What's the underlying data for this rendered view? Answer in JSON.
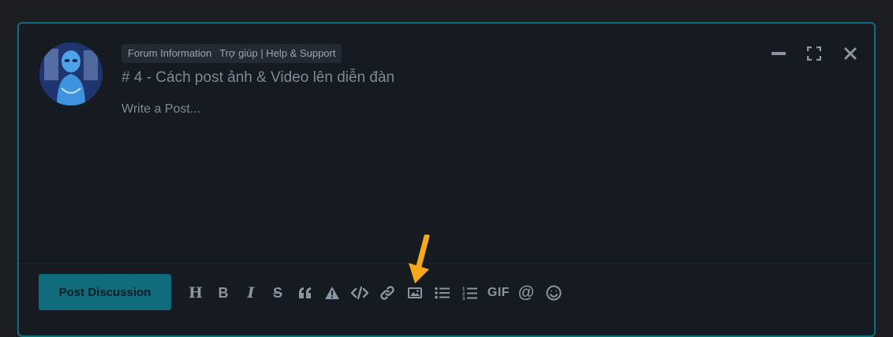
{
  "composer": {
    "tags": [
      "Forum Information",
      "Trợ giúp | Help & Support"
    ],
    "title": "# 4 - Cách post ảnh & Video lên diễn đàn",
    "body_placeholder": "Write a Post...",
    "submit_label": "Post Discussion"
  },
  "toolbar": {
    "items": [
      {
        "icon": "heading-icon",
        "label": "H"
      },
      {
        "icon": "bold-icon",
        "label": "B"
      },
      {
        "icon": "italic-icon",
        "label": "I"
      },
      {
        "icon": "strikethrough-icon",
        "label": "S"
      },
      {
        "icon": "quote-icon",
        "label": ""
      },
      {
        "icon": "spoiler-icon",
        "label": ""
      },
      {
        "icon": "code-icon",
        "label": ""
      },
      {
        "icon": "link-icon",
        "label": ""
      },
      {
        "icon": "image-icon",
        "label": ""
      },
      {
        "icon": "unordered-list-icon",
        "label": ""
      },
      {
        "icon": "ordered-list-icon",
        "label": ""
      },
      {
        "icon": "gif-icon",
        "label": "GIF"
      },
      {
        "icon": "mention-icon",
        "label": "@"
      },
      {
        "icon": "emoji-icon",
        "label": ""
      }
    ]
  },
  "window_controls": [
    "minimize-icon",
    "fullscreen-icon",
    "close-icon"
  ],
  "colors": {
    "page_bg": "#1c1e22",
    "panel_bg": "#161a21",
    "accent": "#0f6e80",
    "icon": "#8a96a2",
    "annotation_arrow": "#f5a81c"
  }
}
